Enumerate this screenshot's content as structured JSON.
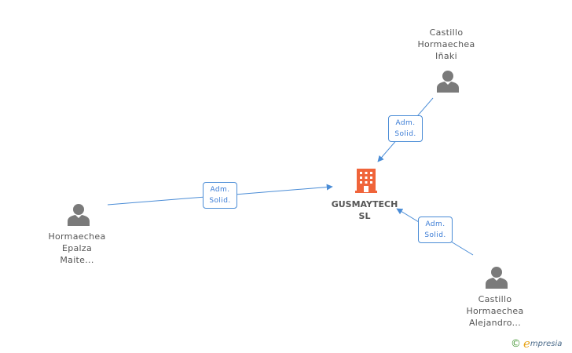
{
  "company": {
    "name_line1": "GUSMAYTECH",
    "name_line2": "SL",
    "icon": "office-building-icon",
    "color": "#f0643a"
  },
  "people": [
    {
      "id": "inaki",
      "lines": [
        "Castillo",
        "Hormaechea",
        "Iñaki"
      ],
      "icon": "person-icon"
    },
    {
      "id": "maite",
      "lines": [
        "Hormaechea",
        "Epalza",
        "Maite..."
      ],
      "icon": "person-icon"
    },
    {
      "id": "alejandro",
      "lines": [
        "Castillo",
        "Hormaechea",
        "Alejandro..."
      ],
      "icon": "person-icon"
    }
  ],
  "relations": [
    {
      "from": "inaki",
      "to": "company",
      "line1": "Adm.",
      "line2": "Solid."
    },
    {
      "from": "maite",
      "to": "company",
      "line1": "Adm.",
      "line2": "Solid."
    },
    {
      "from": "alejandro",
      "to": "company",
      "line1": "Adm.",
      "line2": "Solid."
    }
  ],
  "brand": {
    "copyright": "©",
    "logo_initial": "e",
    "logo_rest": "mpresia"
  },
  "colors": {
    "edge": "#4a8cd6",
    "person": "#7a7a7a",
    "text": "#555555"
  }
}
